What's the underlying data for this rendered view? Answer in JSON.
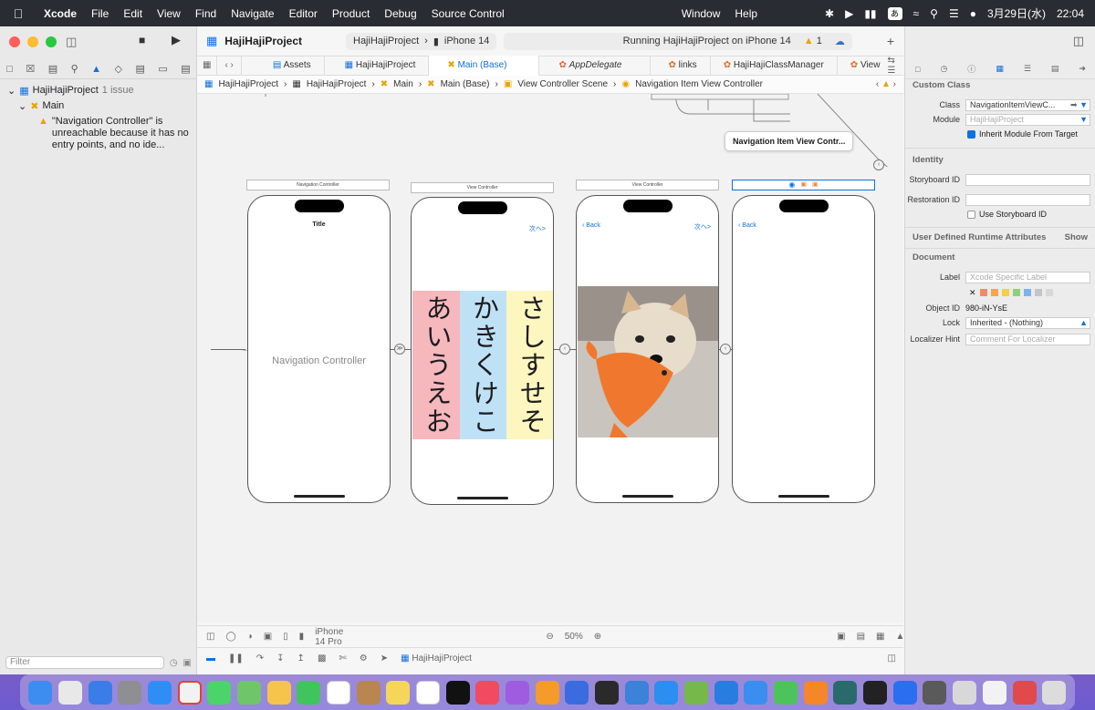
{
  "menubar": {
    "app": "Xcode",
    "items": [
      "File",
      "Edit",
      "View",
      "Find",
      "Navigate",
      "Editor",
      "Product",
      "Debug",
      "Source Control",
      "Window",
      "Help"
    ],
    "input_method": "あ",
    "date": "3月29日(水)",
    "time": "22:04"
  },
  "toolbar": {
    "project": "HajiHajiProject",
    "scheme": "HajiHajiProject",
    "device": "iPhone 14",
    "status": "Running HajiHajiProject on iPhone 14",
    "warnings": "1"
  },
  "tabs": [
    {
      "label": "Assets",
      "italic": false
    },
    {
      "label": "HajiHajiProject",
      "italic": false
    },
    {
      "label": "Main (Base)",
      "italic": false
    },
    {
      "label": "AppDelegate",
      "italic": true
    },
    {
      "label": "links",
      "italic": false
    },
    {
      "label": "HajiHajiClassManager",
      "italic": false
    },
    {
      "label": "View",
      "italic": false
    }
  ],
  "breadcrumbs": [
    "HajiHajiProject",
    "HajiHajiProject",
    "Main",
    "Main (Base)",
    "View Controller Scene",
    "Navigation Item View Controller"
  ],
  "navigator": {
    "project": "HajiHajiProject",
    "issue_count": "1 issue",
    "group": "Main",
    "warning": "\"Navigation Controller\" is unreachable because it has no entry points, and no ide...",
    "filter_placeholder": "Filter"
  },
  "canvas": {
    "tooltip": "Navigation Item View Contr...",
    "scenes": [
      {
        "bar": "Navigation Controller",
        "title": "Title",
        "center_label": "Navigation Controller"
      },
      {
        "bar": "View Controller",
        "next": "次へ>"
      },
      {
        "bar": "View Controller",
        "back": "Back",
        "next": "次へ>"
      },
      {
        "bar": "",
        "back": "Back"
      }
    ],
    "kana_columns": [
      {
        "text": "あいうえお",
        "color": "#f6b7bd"
      },
      {
        "text": "かきくけこ",
        "color": "#bfe1f6"
      },
      {
        "text": "さしすせそ",
        "color": "#fdf6bf"
      }
    ]
  },
  "bottombar": {
    "device": "iPhone 14 Pro",
    "zoom": "50%",
    "debug_target": "HajiHajiProject"
  },
  "inspector": {
    "custom_class": {
      "header": "Custom Class",
      "class_label": "Class",
      "class_value": "NavigationItemViewC...",
      "module_label": "Module",
      "module_value": "HajiHajiProject",
      "inherit_label": "Inherit Module From Target"
    },
    "identity": {
      "header": "Identity",
      "storyboard_label": "Storyboard ID",
      "restoration_label": "Restoration ID",
      "use_storyboard_label": "Use Storyboard ID"
    },
    "runtime": {
      "header": "User Defined Runtime Attributes",
      "show": "Show"
    },
    "document": {
      "header": "Document",
      "label_label": "Label",
      "label_placeholder": "Xcode Specific Label",
      "object_id_label": "Object ID",
      "object_id_value": "980-iN-YsE",
      "lock_label": "Lock",
      "lock_value": "Inherited - (Nothing)",
      "hint_label": "Localizer Hint",
      "hint_placeholder": "Comment For Localizer"
    }
  },
  "colors": {
    "accent": "#1070e0",
    "warning": "#e8a400",
    "window_close": "#ff5f57",
    "window_min": "#febc2e",
    "window_zoom": "#28c840"
  }
}
